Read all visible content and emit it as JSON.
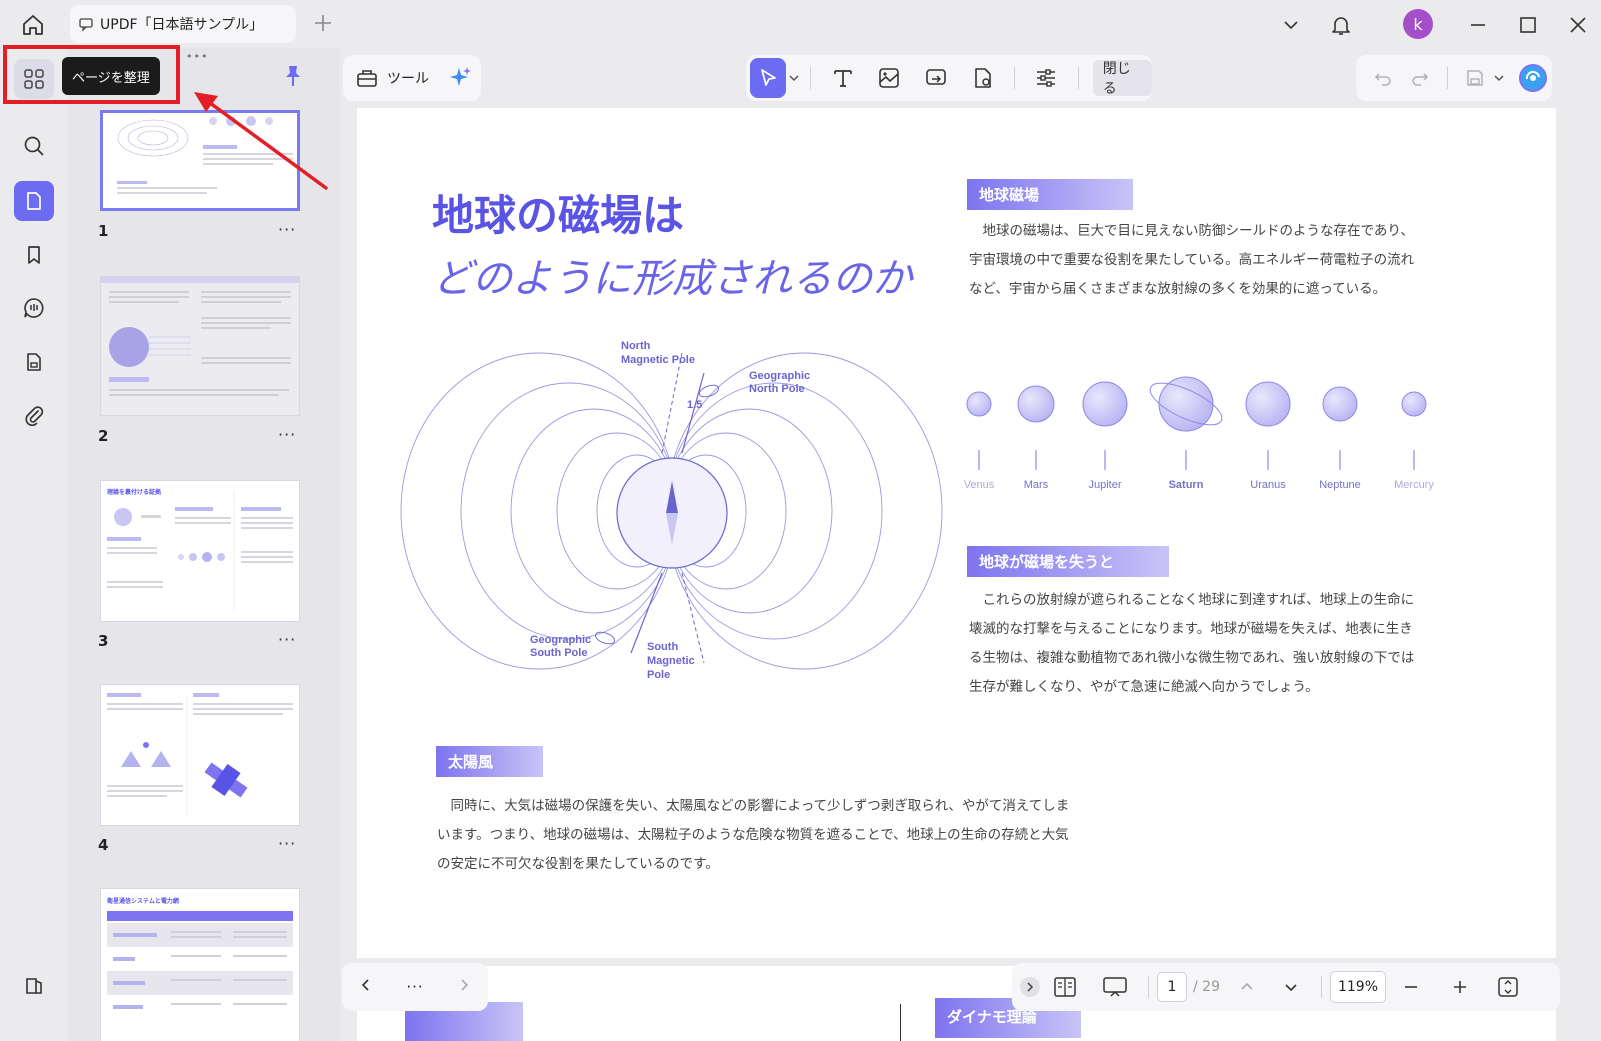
{
  "titlebar": {
    "doc_title": "UPDF「日本語サンプル」",
    "avatar_letter": "k"
  },
  "tooltip": "ページを整理",
  "thumbnails": [
    {
      "number": "1",
      "more": "···"
    },
    {
      "number": "2",
      "more": "···"
    },
    {
      "number": "3",
      "more": "···"
    },
    {
      "number": "4",
      "more": "···"
    }
  ],
  "thumb_mini": {
    "p3_title": "理論を裏付ける証拠",
    "p5_title": "衛星通信システムと電力網"
  },
  "toolbar": {
    "tools_label": "ツール",
    "close_label": "閉じる"
  },
  "page": {
    "title_line1": "地球の磁場は",
    "title_line2": "どのように形成されるのか",
    "section1_head": "地球磁場",
    "section1_body": [
      "地球の磁場は、巨大で目に見えない防御シールドのような存在であり、",
      "宇宙環境の中で重要な役割を果たしている。高エネルギー荷電粒子の流れ",
      "など、宇宙から届くさまざまな放射線の多くを効果的に遮っている。"
    ],
    "section2_head": "地球が磁場を失うと",
    "section2_body": [
      "これらの放射線が遮られることなく地球に到達すれば、地球上の生命に",
      "壊滅的な打撃を与えることになります。地球が磁場を失えば、地表に生き",
      "る生物は、複雑な動植物であれ微小な微生物であれ、強い放射線の下では",
      "生存が難しくなり、やがて急速に絶滅へ向かうでしょう。"
    ],
    "section3_head": "太陽風",
    "section3_body": [
      "同時に、大気は磁場の保護を失い、太陽風などの影響によって少しずつ剥ぎ取られ、やがて消えてしま",
      "います。つまり、地球の磁場は、太陽粒子のような危険な物質を遮ることで、地球上の生命の存続と大気",
      "の安定に不可欠な役割を果たしているのです。"
    ],
    "planets": [
      "Venus",
      "Mars",
      "Jupiter",
      "Saturn",
      "Uranus",
      "Neptune",
      "Mercury"
    ],
    "diagram": {
      "north_magnetic_pole": [
        "North",
        "Magnetic Pole"
      ],
      "geographic_north_pole": [
        "Geographic",
        "North Pole"
      ],
      "geographic_south_pole": [
        "Geographic",
        "South Pole"
      ],
      "south_magnetic_pole": [
        "South",
        "Magnetic",
        "Pole"
      ],
      "angle": "1.5"
    },
    "lower_heading_partial": "ダイナモ理論"
  },
  "bottom_bar": {
    "current_page": "1",
    "total_pages": "/ 29",
    "zoom": "119%",
    "more": "···"
  },
  "colors": {
    "accent": "#6c6cf2",
    "title_purple": "#5a54e6",
    "highlight_red": "#e41e26"
  }
}
